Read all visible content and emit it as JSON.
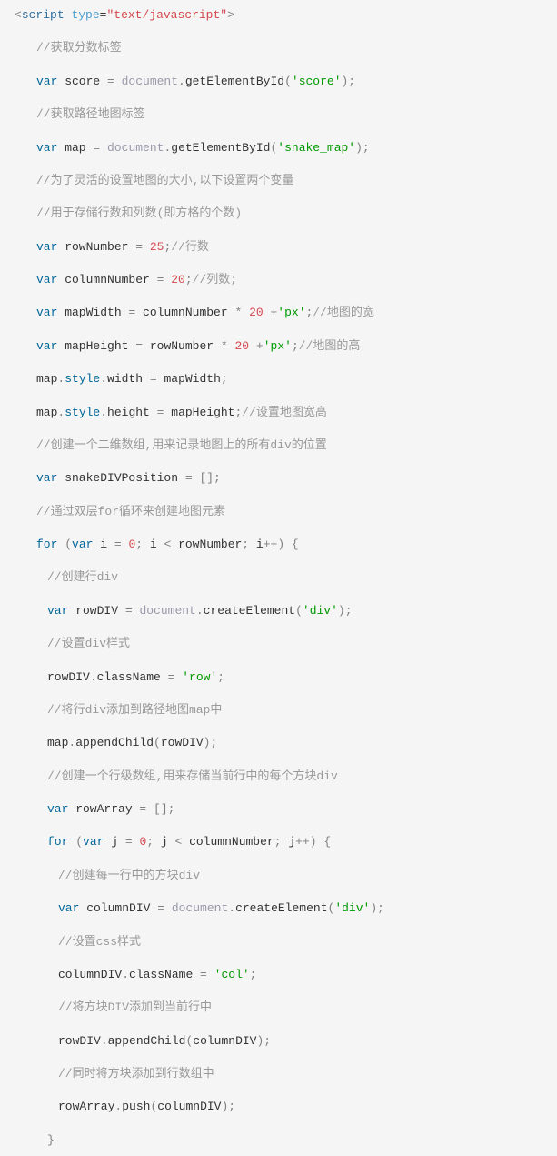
{
  "code": {
    "tag_open_bracket": "<",
    "tag_name": "script",
    "attr_type": "type",
    "attr_type_val": "\"text/javascript\"",
    "tag_close_bracket": ">",
    "c1": "//获取分数标签",
    "l2_var": "var",
    "l2_name": " score ",
    "l2_eq": "=",
    "l2_doc": " document",
    "l2_dot": ".",
    "l2_method": "getElementById",
    "l2_p1": "(",
    "l2_arg": "'score'",
    "l2_p2": ");",
    "c3": "//获取路径地图标签",
    "l4_var": "var",
    "l4_name": " map ",
    "l4_eq": "=",
    "l4_doc": " document",
    "l4_dot": ".",
    "l4_method": "getElementById",
    "l4_p1": "(",
    "l4_arg": "'snake_map'",
    "l4_p2": ");",
    "c5": "//为了灵活的设置地图的大小,以下设置两个变量",
    "c6": "//用于存储行数和列数(即方格的个数)",
    "l7_var": "var",
    "l7_name": " rowNumber ",
    "l7_eq": "=",
    "l7_num": " 25",
    "l7_semi": ";",
    "l7_comment": "//行数",
    "l8_var": "var",
    "l8_name": " columnNumber ",
    "l8_eq": "=",
    "l8_num": " 20",
    "l8_semi": ";",
    "l8_comment": "//列数;",
    "l9_var": "var",
    "l9_name": " mapWidth ",
    "l9_eq": "=",
    "l9_expr": " columnNumber ",
    "l9_star": "*",
    "l9_num": " 20 ",
    "l9_plus": "+",
    "l9_str": "'px'",
    "l9_semi": ";",
    "l9_comment": "//地图的宽",
    "l10_var": "var",
    "l10_name": " mapHeight ",
    "l10_eq": "=",
    "l10_expr": " rowNumber ",
    "l10_star": "*",
    "l10_num": " 20 ",
    "l10_plus": "+",
    "l10_str": "'px'",
    "l10_semi": ";",
    "l10_comment": "//地图的高",
    "l11_a": "map",
    "l11_b": ".",
    "l11_c": "style",
    "l11_d": ".",
    "l11_e": "width ",
    "l11_f": "=",
    "l11_g": " mapWidth",
    "l11_h": ";",
    "l12_a": "map",
    "l12_b": ".",
    "l12_c": "style",
    "l12_d": ".",
    "l12_e": "height ",
    "l12_f": "=",
    "l12_g": " mapHeight",
    "l12_h": ";",
    "l12_comment": "//设置地图宽高",
    "c13": "//创建一个二维数组,用来记录地图上的所有div的位置",
    "l14_var": "var",
    "l14_name": " snakeDIVPosition ",
    "l14_eq": "=",
    "l14_br": " [];",
    "c15": "//通过双层for循环来创建地图元素",
    "l16_for": "for",
    "l16_p1": " (",
    "l16_var": "var",
    "l16_i": " i ",
    "l16_eq": "=",
    "l16_num": " 0",
    "l16_semi1": ";",
    "l16_cond": " i ",
    "l16_lt": "<",
    "l16_rn": " rowNumber",
    "l16_semi2": ";",
    "l16_inc": " i",
    "l16_pp": "++",
    "l16_p2": ") {",
    "c17": "//创建行div",
    "l18_var": "var",
    "l18_name": " rowDIV ",
    "l18_eq": "=",
    "l18_doc": " document",
    "l18_dot": ".",
    "l18_method": "createElement",
    "l18_p1": "(",
    "l18_arg": "'div'",
    "l18_p2": ");",
    "c19": "//设置div样式",
    "l20_a": "rowDIV",
    "l20_b": ".",
    "l20_c": "className ",
    "l20_d": "=",
    "l20_e": " 'row'",
    "l20_f": ";",
    "c21": "//将行div添加到路径地图map中",
    "l22_a": "map",
    "l22_b": ".",
    "l22_c": "appendChild",
    "l22_d": "(",
    "l22_e": "rowDIV",
    "l22_f": ");",
    "c23": "//创建一个行级数组,用来存储当前行中的每个方块div",
    "l24_var": "var",
    "l24_name": " rowArray ",
    "l24_eq": "=",
    "l24_br": " [];",
    "l25_for": "for",
    "l25_p1": " (",
    "l25_var": "var",
    "l25_j": " j ",
    "l25_eq": "=",
    "l25_num": " 0",
    "l25_semi1": ";",
    "l25_cond": " j ",
    "l25_lt": "<",
    "l25_cn": " columnNumber",
    "l25_semi2": ";",
    "l25_inc": " j",
    "l25_pp": "++",
    "l25_p2": ") {",
    "c26": "//创建每一行中的方块div",
    "l27_var": "var",
    "l27_name": " columnDIV ",
    "l27_eq": "=",
    "l27_doc": " document",
    "l27_dot": ".",
    "l27_method": "createElement",
    "l27_p1": "(",
    "l27_arg": "'div'",
    "l27_p2": ");",
    "c28": "//设置css样式",
    "l29_a": "columnDIV",
    "l29_b": ".",
    "l29_c": "className ",
    "l29_d": "=",
    "l29_e": " 'col'",
    "l29_f": ";",
    "c30": "//将方块DIV添加到当前行中",
    "l31_a": "rowDIV",
    "l31_b": ".",
    "l31_c": "appendChild",
    "l31_d": "(",
    "l31_e": "columnDIV",
    "l31_f": ");",
    "c32": "//同时将方块添加到行数组中",
    "l33_a": "rowArray",
    "l33_b": ".",
    "l33_c": "push",
    "l33_d": "(",
    "l33_e": "columnDIV",
    "l33_f": ");",
    "l34_cb": "}"
  }
}
